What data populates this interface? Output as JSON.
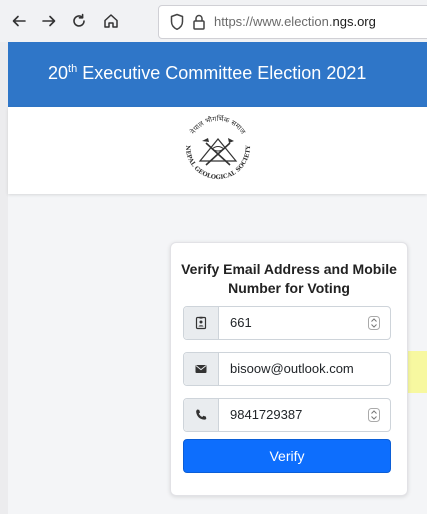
{
  "browser": {
    "url_dim": "https://www.election.",
    "url_domain": "ngs.org"
  },
  "header": {
    "title_pre": "20",
    "title_sup": "th",
    "title_post": " Executive Committee Election 2021"
  },
  "logo": {
    "name": "Nepal Geological Society seal",
    "text_top": "नेपाल भौगर्भिक समाज",
    "text_ring": "NEPAL GEOLOGICAL SOCIETY"
  },
  "form": {
    "title": "Verify Email Address and Mobile Number for Voting",
    "id_value": "661",
    "email_value": "bisoow@outlook.com",
    "mobile_value": "9841729387",
    "submit_label": "Verify"
  },
  "colors": {
    "header": "#2f76c8",
    "primary_button": "#0d6efd",
    "highlight": "#faf85a"
  },
  "icons": {
    "back": "arrow-left-icon",
    "forward": "arrow-right-icon",
    "reload": "reload-icon",
    "home": "home-icon",
    "shield": "shield-icon",
    "lock": "lock-icon",
    "id": "id-badge-icon",
    "email": "envelope-icon",
    "phone": "phone-icon",
    "spin": "spinner-arrows-icon"
  }
}
